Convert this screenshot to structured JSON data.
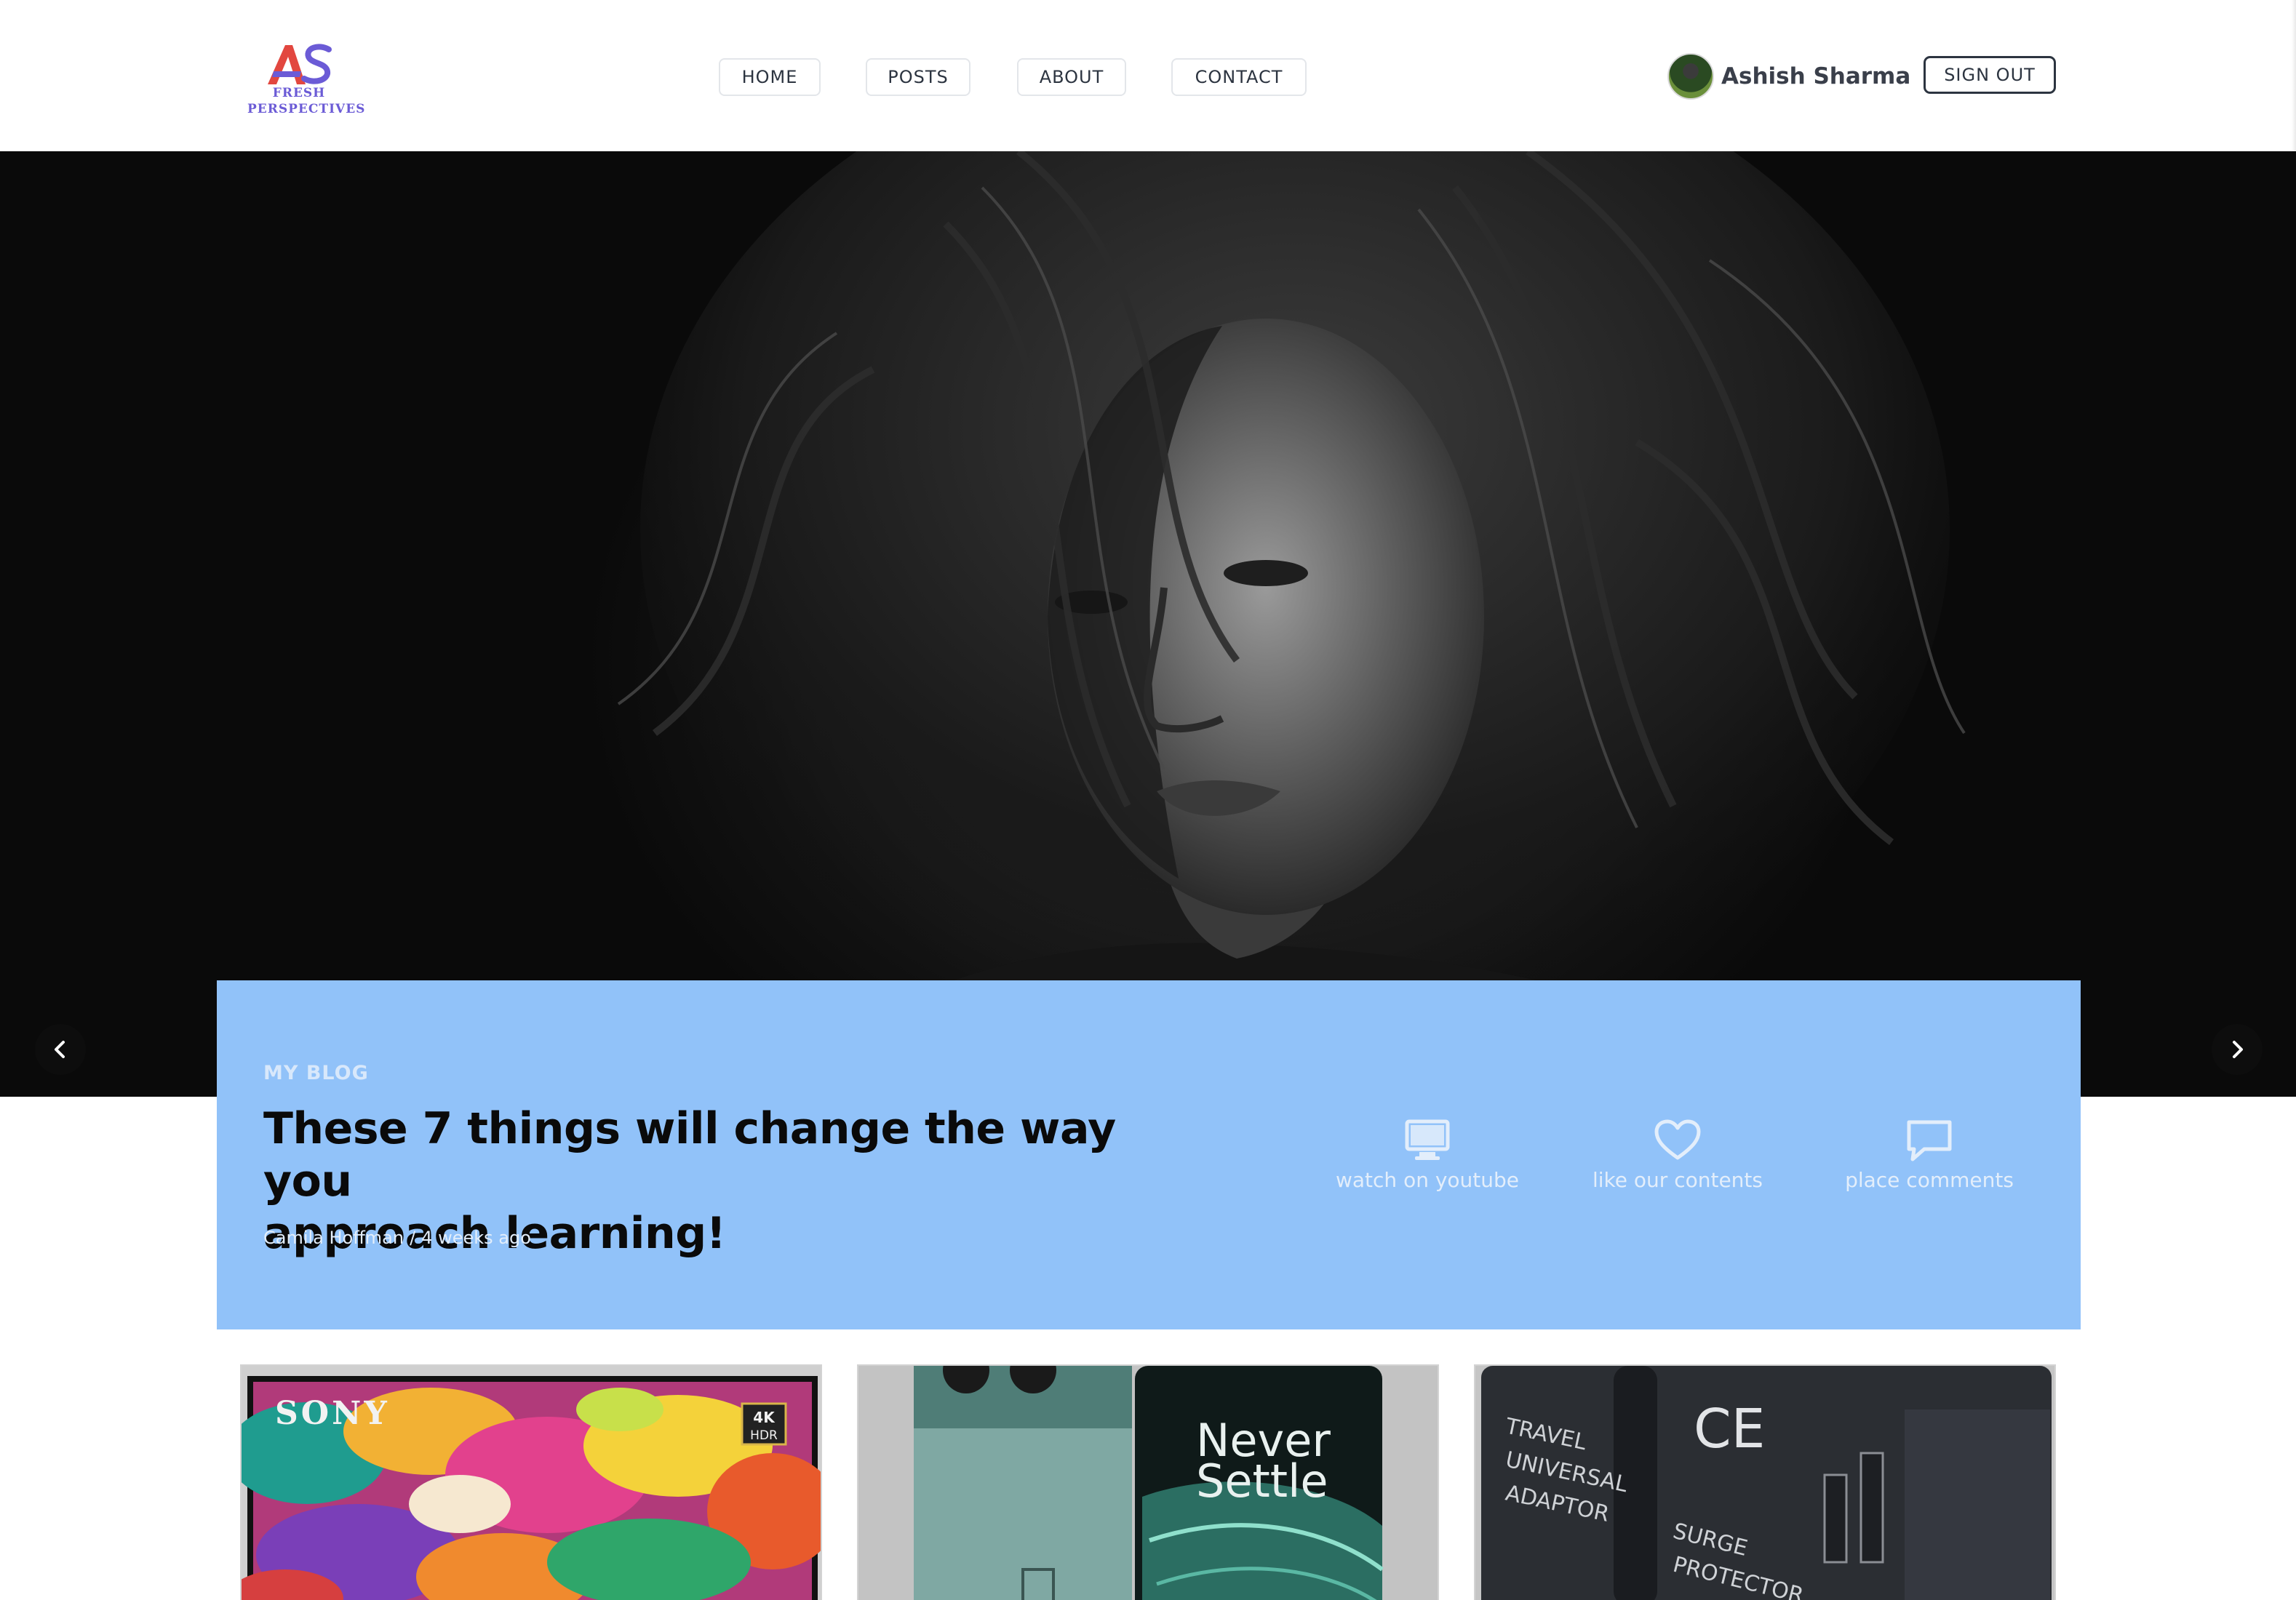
{
  "brand": {
    "mark": "AS",
    "line1": "FRESH",
    "line2": "PERSPECTIVES",
    "colors": {
      "primary": "#e2473f",
      "secondary": "#6b5bd6"
    }
  },
  "nav": {
    "items": [
      {
        "label": "HOME"
      },
      {
        "label": "POSTS"
      },
      {
        "label": "ABOUT"
      },
      {
        "label": "CONTACT"
      }
    ]
  },
  "user": {
    "name": "Ashish Sharma",
    "signout_label": "SIGN OUT",
    "avatar_icon": "avatar-photo"
  },
  "hero": {
    "prev_icon": "chevron-left-icon",
    "next_icon": "chevron-right-icon"
  },
  "feature": {
    "kicker": "MY BLOG",
    "headline_line1": "These 7 things will change the way you",
    "headline_line2": "approach learning!",
    "author": "Camila Hoffman",
    "separator": "/",
    "time": "4 weeks ago",
    "bg_color": "#91c2f9",
    "actions": [
      {
        "label": "watch on youtube",
        "icon": "monitor-icon"
      },
      {
        "label": "like our contents",
        "icon": "heart-icon"
      },
      {
        "label": "place comments",
        "icon": "comment-icon"
      }
    ]
  },
  "cards": [
    {
      "brand_text": "SONY",
      "badge_top": "4K",
      "badge_bottom": "HDR"
    },
    {
      "tagline_line1": "Never",
      "tagline_line2": "Settle"
    },
    {
      "label_lines": [
        "TRAVEL",
        "UNIVERSAL",
        "ADAPTOR"
      ],
      "mark": "CE",
      "label2_lines": [
        "SURGE",
        "PROTECTOR"
      ]
    }
  ]
}
